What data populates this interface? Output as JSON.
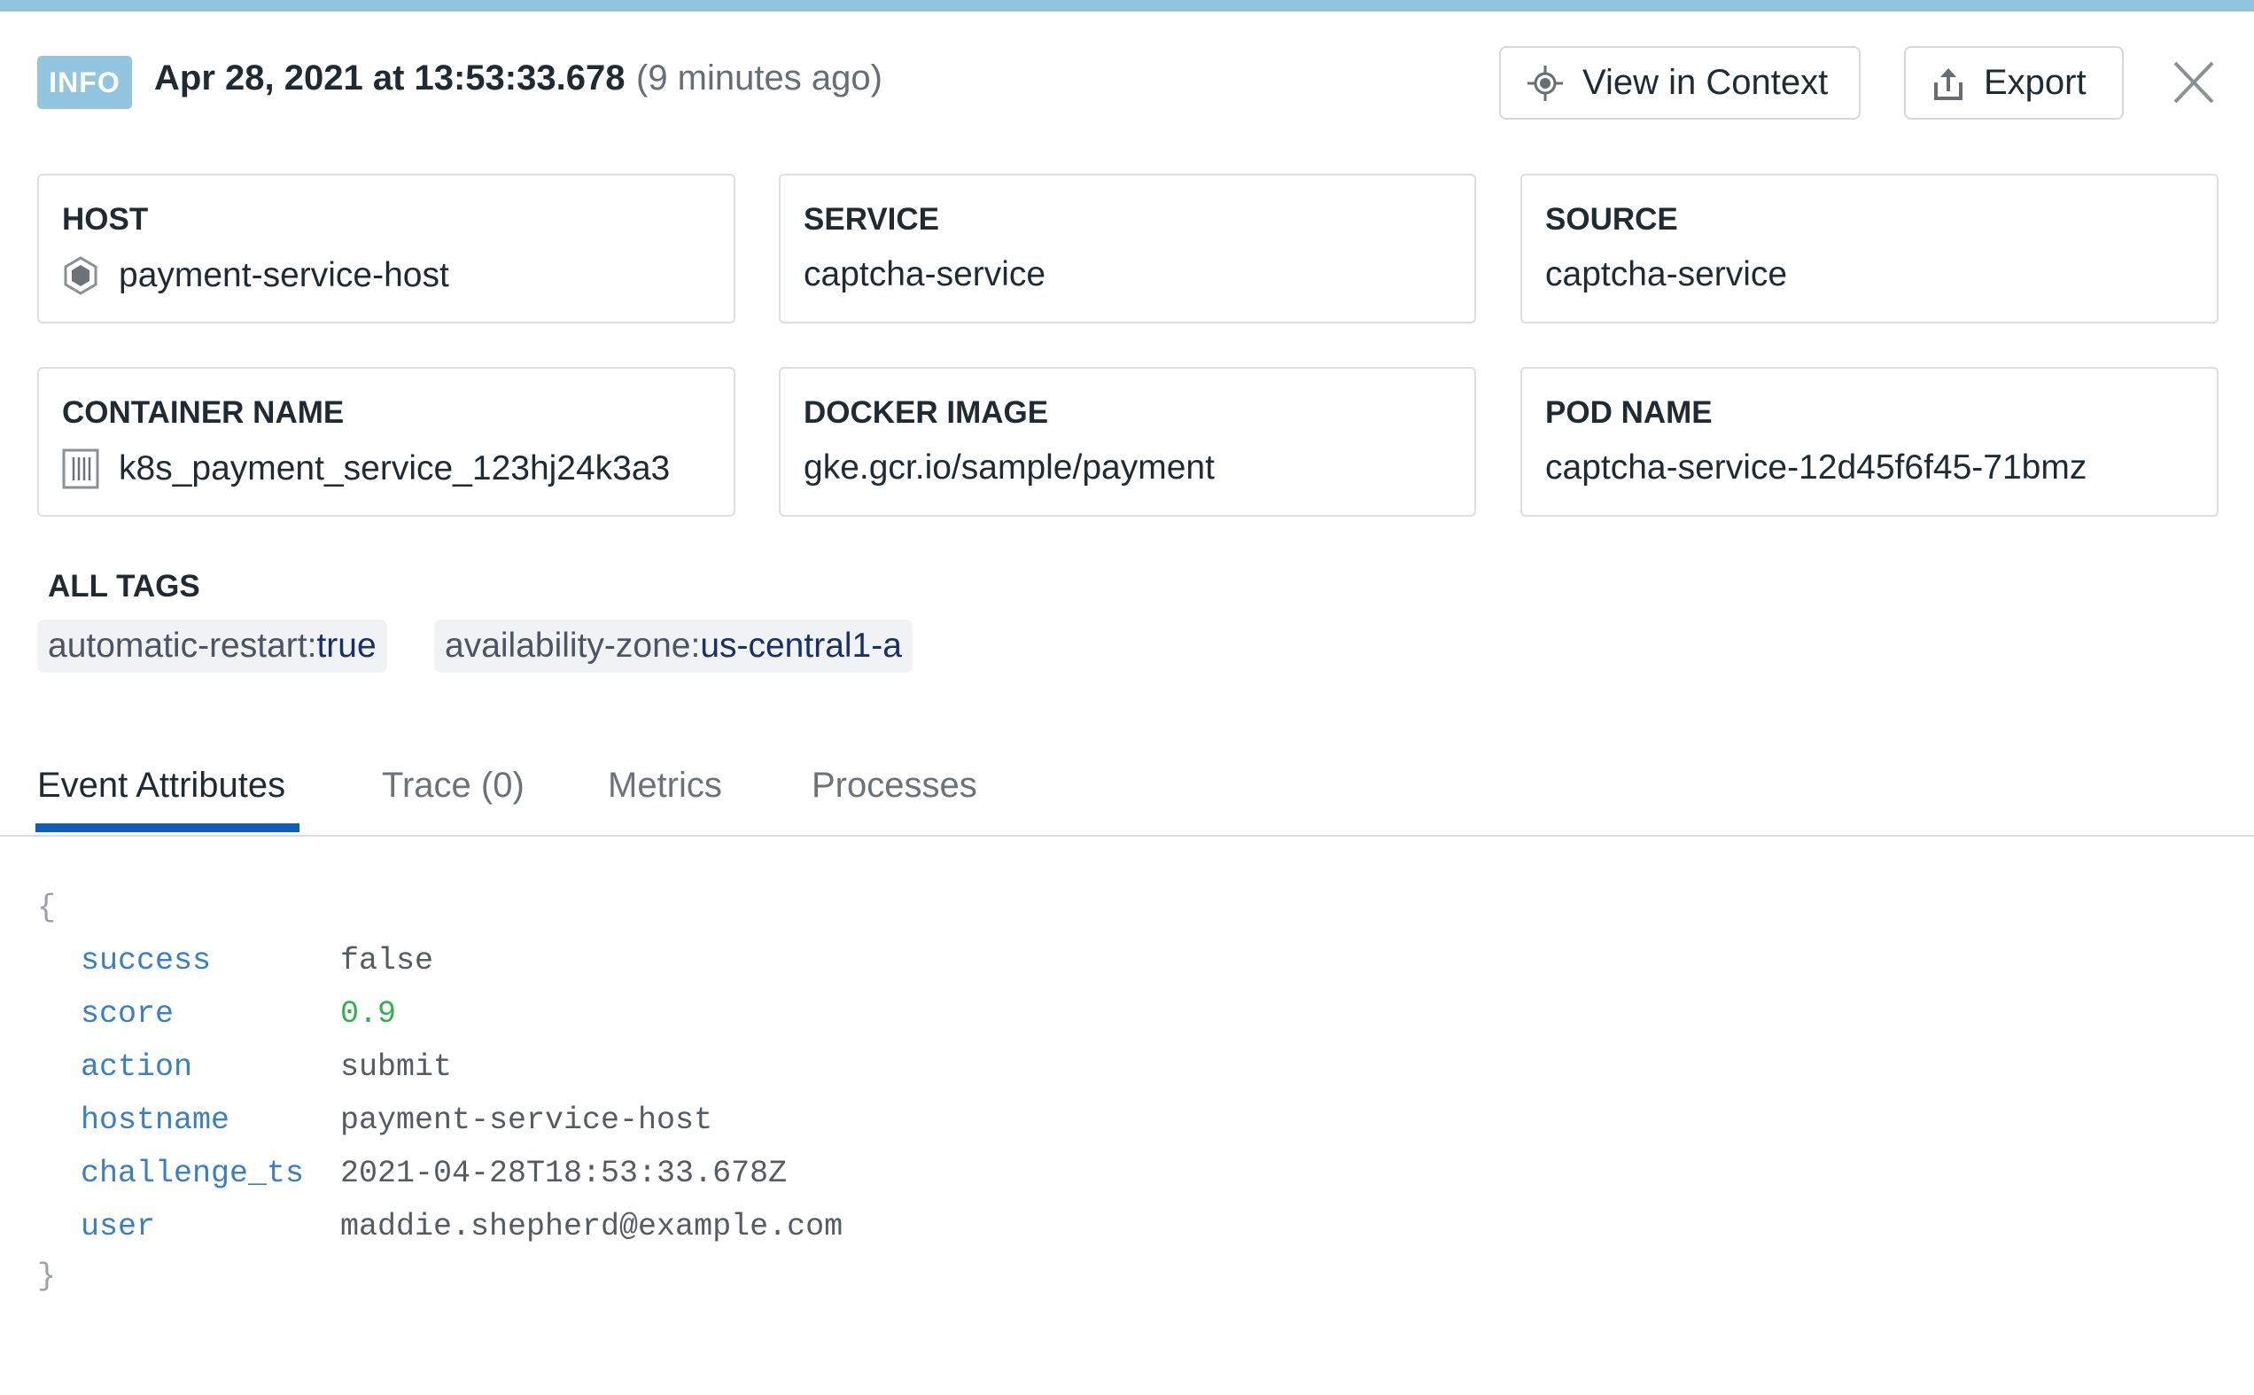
{
  "header": {
    "level": "INFO",
    "timestamp": "Apr 28, 2021 at 13:53:33.678",
    "relative_time": "(9 minutes ago)",
    "view_in_context_label": "View in Context",
    "export_label": "Export"
  },
  "cards": [
    {
      "label": "HOST",
      "value": "payment-service-host",
      "icon": "hexagon-icon"
    },
    {
      "label": "SERVICE",
      "value": "captcha-service"
    },
    {
      "label": "SOURCE",
      "value": "captcha-service"
    },
    {
      "label": "CONTAINER NAME",
      "value": "k8s_payment_service_123hj24k3a3",
      "icon": "container-icon"
    },
    {
      "label": "DOCKER IMAGE",
      "value": "gke.gcr.io/sample/payment"
    },
    {
      "label": "POD NAME",
      "value": "captcha-service-12d45f6f45-71bmz"
    }
  ],
  "tags": {
    "title": "ALL TAGS",
    "items": [
      {
        "key": "automatic-restart:",
        "value": "true"
      },
      {
        "key": "availability-zone:",
        "value": "us-central1-a"
      }
    ]
  },
  "tabs": [
    {
      "label": "Event Attributes",
      "active": true
    },
    {
      "label": "Trace (0)"
    },
    {
      "label": "Metrics"
    },
    {
      "label": "Processes"
    }
  ],
  "attributes": {
    "open": "{",
    "close": "}",
    "rows": [
      {
        "key": "success",
        "value": "false"
      },
      {
        "key": "score",
        "value": "0.9"
      },
      {
        "key": "action",
        "value": "submit"
      },
      {
        "key": "hostname",
        "value": "payment-service-host"
      },
      {
        "key": "challenge_ts",
        "value": "2021-04-28T18:53:33.678Z"
      },
      {
        "key": "user",
        "value": "maddie.shepherd@example.com"
      }
    ]
  },
  "colors": {
    "accent": "#0d5fbd",
    "info": "#92c5df",
    "key": "#3a7fc6",
    "number": "#2db34a"
  }
}
